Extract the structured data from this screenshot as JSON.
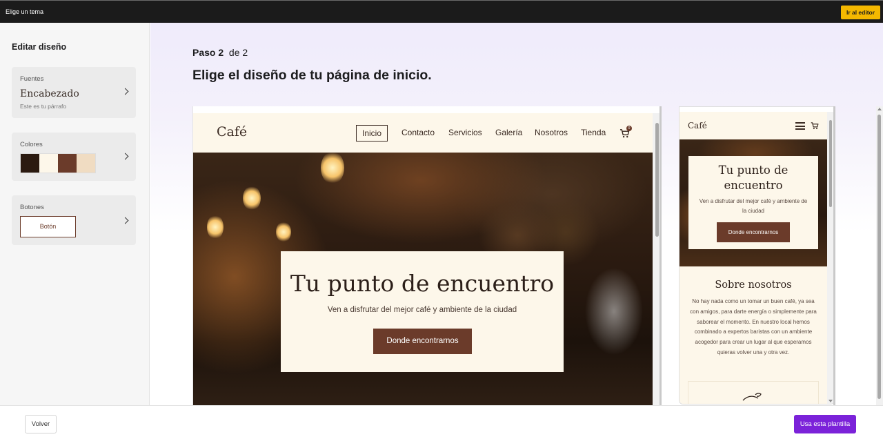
{
  "topbar": {
    "title": "Elige un tema",
    "editor_button": "Ir al editor"
  },
  "sidebar": {
    "heading": "Editar diseño",
    "fonts": {
      "label": "Fuentes",
      "heading_sample": "Encabezado",
      "paragraph_sample": "Este es tu párrafo"
    },
    "colors": {
      "label": "Colores",
      "swatches": [
        "#2b1a10",
        "#fdf7ea",
        "#6b3b2a",
        "#f0dcc2"
      ]
    },
    "buttons": {
      "label": "Botones",
      "sample": "Botón"
    }
  },
  "main": {
    "step_label": "Paso 2",
    "step_of": "de 2",
    "title": "Elige el diseño de tu página de inicio."
  },
  "desktop_preview": {
    "logo": "Café",
    "menu": [
      "Inicio",
      "Contacto",
      "Servicios",
      "Galería",
      "Nosotros",
      "Tienda"
    ],
    "cart_count": "0",
    "hero_title": "Tu punto de encuentro",
    "hero_subtitle": "Ven a disfrutar del mejor café y ambiente de la ciudad",
    "hero_button": "Donde encontrarnos"
  },
  "mobile_preview": {
    "logo": "Café",
    "cart_count": "0",
    "hero_title": "Tu punto de encuentro",
    "hero_subtitle": "Ven a disfrutar del mejor café y ambiente de la ciudad",
    "hero_button": "Donde encontrarnos",
    "about_title": "Sobre nosotros",
    "about_text": "No hay nada como un tomar un buen café, ya sea con amigos, para darte energía o simplemente para saborear el momento. En nuestro local hemos combinado a expertos baristas con un ambiente acogedor para crear un lugar al que esperamos quieras volver una y otra vez."
  },
  "footer": {
    "back_button": "Volver",
    "use_button": "Usa esta plantilla"
  },
  "colors": {
    "accent_purple": "#7b22d9",
    "editor_yellow": "#f5b800",
    "coffee_brown": "#6b3b2a",
    "cream": "#fdf7ea"
  },
  "icons": [
    "chevron-right-icon",
    "cart-icon",
    "hamburger-menu-icon",
    "coffee-cup-icon"
  ]
}
